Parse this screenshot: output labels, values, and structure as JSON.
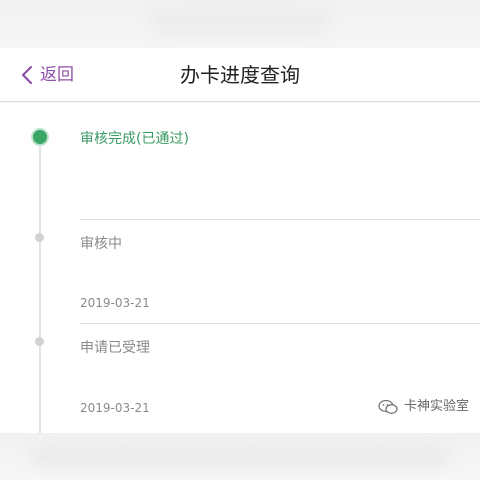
{
  "header": {
    "back_label": "返回",
    "title": "办卡进度查询",
    "back_icon": "chevron-left-icon",
    "accent_color": "#8e4fa6"
  },
  "timeline": {
    "steps": [
      {
        "title": "审核完成(已通过)",
        "date": "",
        "status": "done"
      },
      {
        "title": "审核中",
        "date": "2019-03-21",
        "status": "pending"
      },
      {
        "title": "申请已受理",
        "date": "2019-03-21",
        "status": "pending"
      }
    ],
    "done_color": "#3aa565",
    "pending_color": "#d2d2d2"
  },
  "watermark": {
    "icon": "wechat-icon",
    "text": "卡神实验室"
  }
}
